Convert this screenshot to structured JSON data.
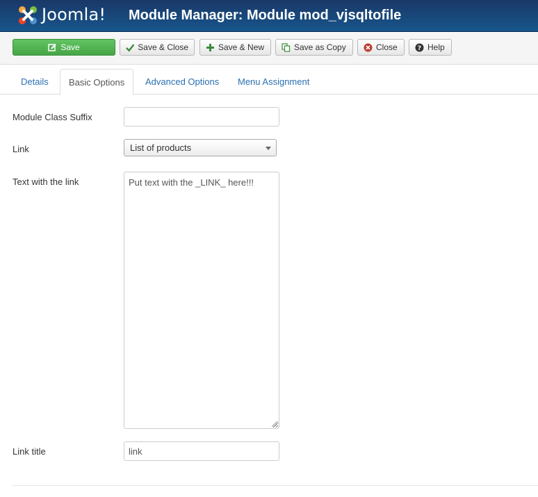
{
  "header": {
    "logo_text": "Joomla!",
    "title": "Module Manager: Module mod_vjsqltofile"
  },
  "toolbar": {
    "save_label": "Save",
    "save_close_label": "Save & Close",
    "save_new_label": "Save & New",
    "save_copy_label": "Save as Copy",
    "close_label": "Close",
    "help_label": "Help"
  },
  "tabs": [
    {
      "label": "Details"
    },
    {
      "label": "Basic Options"
    },
    {
      "label": "Advanced Options"
    },
    {
      "label": "Menu Assignment"
    }
  ],
  "form": {
    "suffix_label": "Module Class Suffix",
    "suffix_value": "",
    "link_label": "Link",
    "link_selected": "List of products",
    "text_label": "Text with the link",
    "text_value": "Put text with the _LINK_ here!!!",
    "title_label": "Link title",
    "title_value": "link"
  },
  "colors": {
    "header": "#1a3867",
    "save_green": "#46a546",
    "link_blue": "#2a6fb0"
  }
}
